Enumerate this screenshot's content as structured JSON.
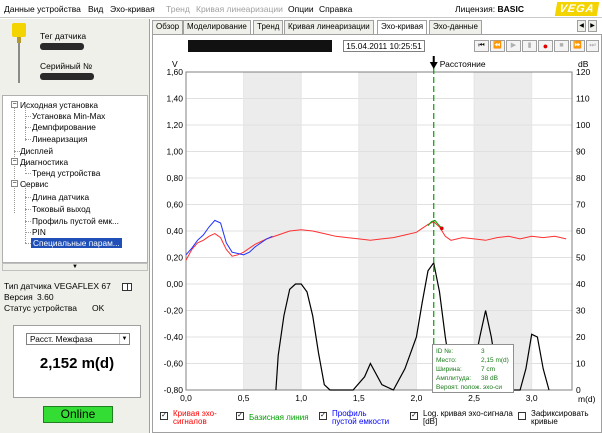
{
  "menu": {
    "items": [
      "Данные устройства",
      "Вид",
      "Эхо-кривая",
      "Тренд",
      "Кривая линеаризации",
      "Опции",
      "Справка"
    ],
    "disabled": [
      false,
      false,
      false,
      true,
      true,
      false,
      false
    ],
    "license_label": "Лицензия:",
    "license_value": "BASIC",
    "logo": "VEGA"
  },
  "sensor": {
    "tag_label": "Тег датчика",
    "serial_label": "Серийный №"
  },
  "tree": {
    "items": [
      {
        "label": "Исходная установка",
        "level": 0,
        "toggle": "-"
      },
      {
        "label": "Установка Min-Max",
        "level": 1
      },
      {
        "label": "Демпфирование",
        "level": 1
      },
      {
        "label": "Линеаризация",
        "level": 1
      },
      {
        "label": "Дисплей",
        "level": 0
      },
      {
        "label": "Диагностика",
        "level": 0,
        "toggle": "-"
      },
      {
        "label": "Тренд устройства",
        "level": 1
      },
      {
        "label": "Сервис",
        "level": 0,
        "toggle": "-"
      },
      {
        "label": "Длина датчика",
        "level": 1
      },
      {
        "label": "Токовый выход",
        "level": 1
      },
      {
        "label": "Профиль пустой емк...",
        "level": 1
      },
      {
        "label": "PIN",
        "level": 1
      },
      {
        "label": "Специальные парам...",
        "level": 1,
        "selected": true
      }
    ]
  },
  "device": {
    "type_label": "Тип датчика",
    "type_value": "VEGAFLEX 67",
    "version_label": "Версия",
    "version_value": "3.60",
    "status_label": "Статус устройства",
    "status_value": "OK"
  },
  "measurement": {
    "selected": "Расст. Межфаза",
    "value": "2,152 m(d)"
  },
  "online": "Online",
  "tabs": [
    "Обзор",
    "Моделирование",
    "Тренд",
    "Кривая линеаризации",
    "Эхо-кривая",
    "Эхо-данные"
  ],
  "active_tab": 4,
  "echo": {
    "timestamp": "15.04.2011 10:25:51",
    "controls": [
      "first-icon",
      "prev-icon",
      "back-icon",
      "play-icon",
      "record-icon",
      "stop-icon",
      "next-icon",
      "last-icon"
    ],
    "marker_label": "Расстояние"
  },
  "chart_data": {
    "type": "line",
    "ylabel_left": "V",
    "ylabel_right": "dB",
    "xlabel": "m(d)",
    "x_ticks": [
      "0,0",
      "0,5",
      "1,0",
      "1,5",
      "2,0",
      "2,5",
      "3,0"
    ],
    "y_left_ticks": [
      "1,60",
      "1,40",
      "1,20",
      "1,00",
      "0,80",
      "0,60",
      "0,40",
      "0,20",
      "0,00",
      "-0,20",
      "-0,40",
      "-0,60",
      "-0,80"
    ],
    "y_right_ticks": [
      "120",
      "110",
      "100",
      "90",
      "80",
      "70",
      "60",
      "50",
      "40",
      "30",
      "20",
      "10",
      "0"
    ],
    "xlim": [
      0,
      3.35
    ],
    "ylim_left": [
      -0.8,
      1.6
    ],
    "ylim_right": [
      0,
      120
    ],
    "marker_x": 2.15,
    "grid": true,
    "series": [
      {
        "name": "Кривая эхо-сигналов",
        "color": "#ff3030",
        "x": [
          0.0,
          0.05,
          0.1,
          0.15,
          0.2,
          0.25,
          0.3,
          0.35,
          0.4,
          0.45,
          0.5,
          0.55,
          0.6,
          0.7,
          0.8,
          0.9,
          1.0,
          1.1,
          1.2,
          1.3,
          1.4,
          1.5,
          1.6,
          1.7,
          1.8,
          1.9,
          2.0,
          2.05,
          2.1,
          2.15,
          2.2,
          2.25,
          2.3,
          2.4,
          2.5,
          2.6,
          2.7,
          2.8,
          2.9,
          3.0,
          3.1,
          3.2,
          3.3
        ],
        "y": [
          0.18,
          0.26,
          0.31,
          0.33,
          0.36,
          0.38,
          0.35,
          0.26,
          0.21,
          0.22,
          0.24,
          0.27,
          0.3,
          0.34,
          0.37,
          0.4,
          0.41,
          0.4,
          0.38,
          0.36,
          0.35,
          0.34,
          0.33,
          0.34,
          0.35,
          0.37,
          0.39,
          0.42,
          0.45,
          0.47,
          0.43,
          0.36,
          0.33,
          0.35,
          0.34,
          0.33,
          0.35,
          0.36,
          0.34,
          0.36,
          0.35,
          0.36,
          0.34
        ]
      },
      {
        "name": "Базисная линия",
        "color": "#00a000",
        "x": [
          2.1,
          2.13,
          2.16,
          2.19,
          2.22
        ],
        "y": [
          0.44,
          0.47,
          0.48,
          0.45,
          0.42
        ]
      },
      {
        "name": "Профиль пустой емкости",
        "color": "#2030ff",
        "x": [
          0.0,
          0.05,
          0.1,
          0.15,
          0.2,
          0.25,
          0.3,
          0.35,
          0.4,
          0.45,
          0.5,
          0.55,
          0.6,
          0.65,
          0.7,
          0.75
        ],
        "y": [
          0.22,
          0.27,
          0.33,
          0.37,
          0.43,
          0.48,
          0.46,
          0.31,
          0.24,
          0.23,
          0.22,
          0.24,
          0.28,
          0.31,
          0.34,
          0.36
        ]
      },
      {
        "name": "Log. кривая эхо-сигнала [dB]",
        "color": "#000000",
        "x": [
          0.78,
          0.8,
          0.85,
          0.9,
          0.95,
          1.0,
          1.05,
          1.1,
          1.15,
          1.2,
          1.25,
          1.3,
          1.35,
          1.45,
          1.55,
          1.6,
          1.7,
          1.8,
          1.9,
          2.0,
          2.05,
          2.1,
          2.15,
          2.2,
          2.25,
          2.3,
          2.35,
          2.4,
          2.45,
          2.5,
          2.55,
          2.6,
          2.65,
          2.7,
          2.8,
          2.9,
          2.95,
          3.0,
          3.05,
          3.1,
          3.15
        ],
        "y": [
          0.0,
          13.0,
          28.0,
          38.0,
          40.0,
          40.0,
          37.0,
          28.0,
          14.0,
          2.0,
          0.0,
          0.0,
          0.0,
          0.0,
          5.0,
          10.0,
          2.0,
          0.0,
          8.0,
          20.0,
          33.0,
          45.0,
          48.0,
          37.0,
          20.0,
          6.0,
          0.0,
          0.0,
          2.0,
          9.0,
          20.0,
          30.0,
          20.0,
          6.0,
          0.0,
          0.0,
          8.0,
          21.0,
          20.0,
          8.0,
          0.0
        ]
      }
    ]
  },
  "legend": [
    {
      "label": "Кривая эхо-сигналов",
      "color": "#ff0000",
      "checked": true
    },
    {
      "label": "Базисная линия",
      "color": "#00a000",
      "checked": true
    },
    {
      "label": "Профиль пустой емкости",
      "color": "#0000ff",
      "checked": true
    },
    {
      "label": "Log. кривая эхо-сигнала [dB]",
      "color": "#000000",
      "checked": true
    },
    {
      "label": "Зафиксировать кривые",
      "color": "#000000",
      "checked": false
    }
  ],
  "tooltip": {
    "rows": [
      {
        "label": "ID №:",
        "value": "3"
      },
      {
        "label": "Место:",
        "value": "2,15 m(d)"
      },
      {
        "label": "Ширина:",
        "value": "7 cm"
      },
      {
        "label": "Амплитуда:",
        "value": "38 dB"
      },
      {
        "label": "Вероят. полож. эхо-си",
        "value": ""
      }
    ]
  }
}
